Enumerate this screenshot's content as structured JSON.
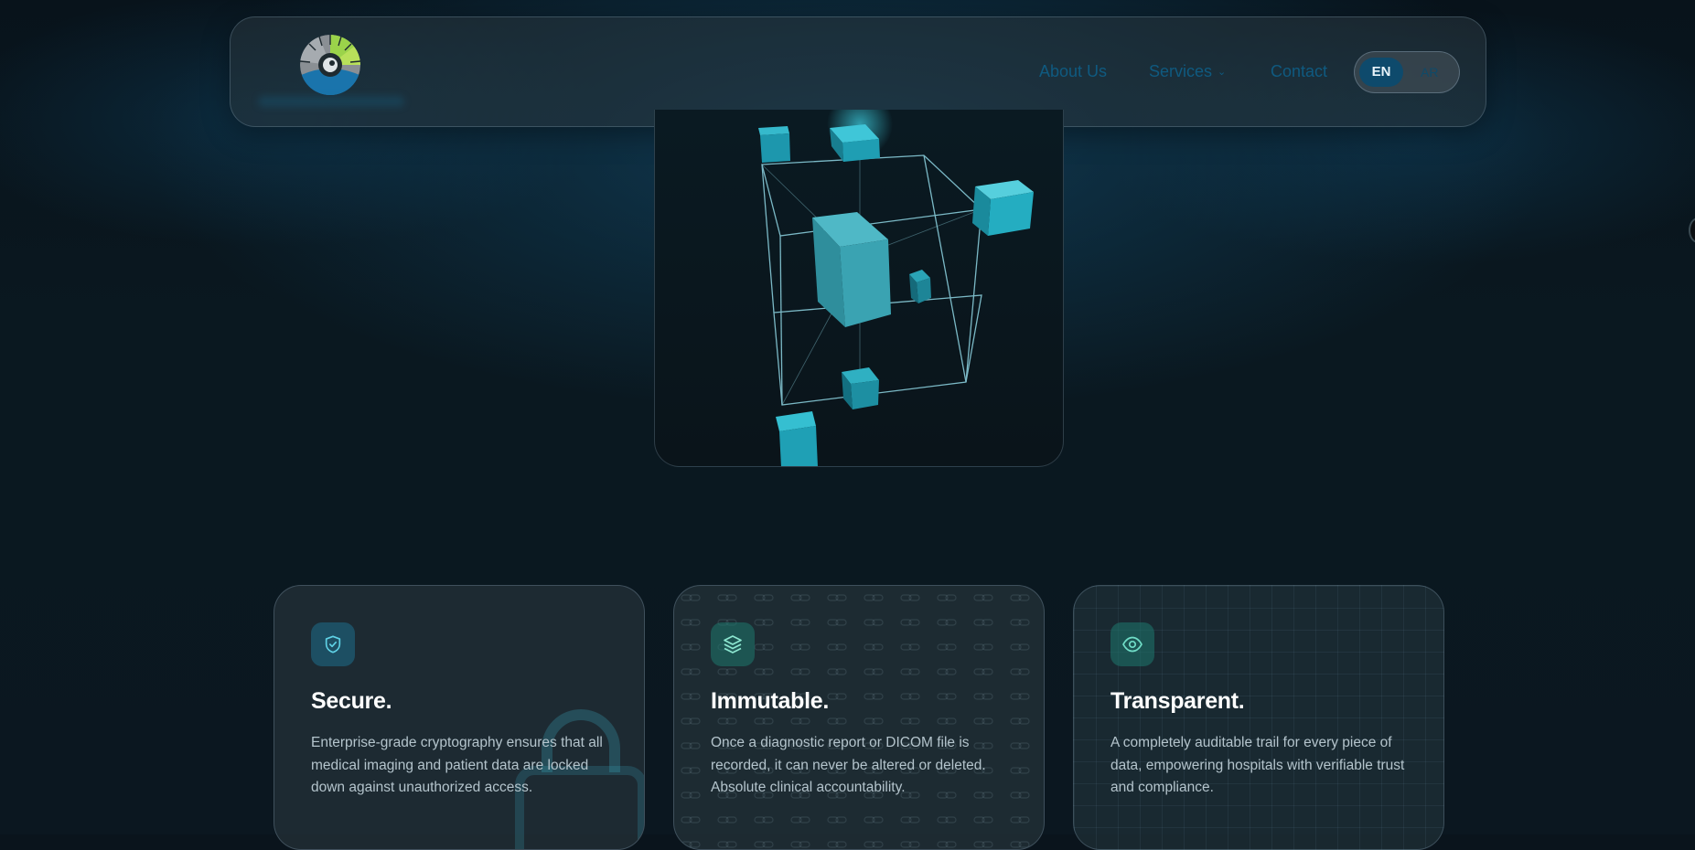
{
  "nav": {
    "about": "About Us",
    "services": "Services",
    "contact": "Contact",
    "lang_en": "EN",
    "lang_ar": "AR"
  },
  "features": [
    {
      "icon": "shield-check-icon",
      "title": "Secure.",
      "text": "Enterprise-grade cryptography ensures that all medical imaging and patient data are locked down against unauthorized access."
    },
    {
      "icon": "layers-icon",
      "title": "Immutable.",
      "text": "Once a diagnostic report or DICOM file is recorded, it can never be altered or deleted. Absolute clinical accountability."
    },
    {
      "icon": "eye-icon",
      "title": "Transparent.",
      "text": "A completely auditable trail for every piece of data, empowering hospitals with verifiable trust and compliance."
    }
  ],
  "colors": {
    "accent": "#0e4a6c",
    "nav_link": "#0f5a80",
    "cube": "#22a8bc",
    "logo_green": "#9bd34a"
  }
}
